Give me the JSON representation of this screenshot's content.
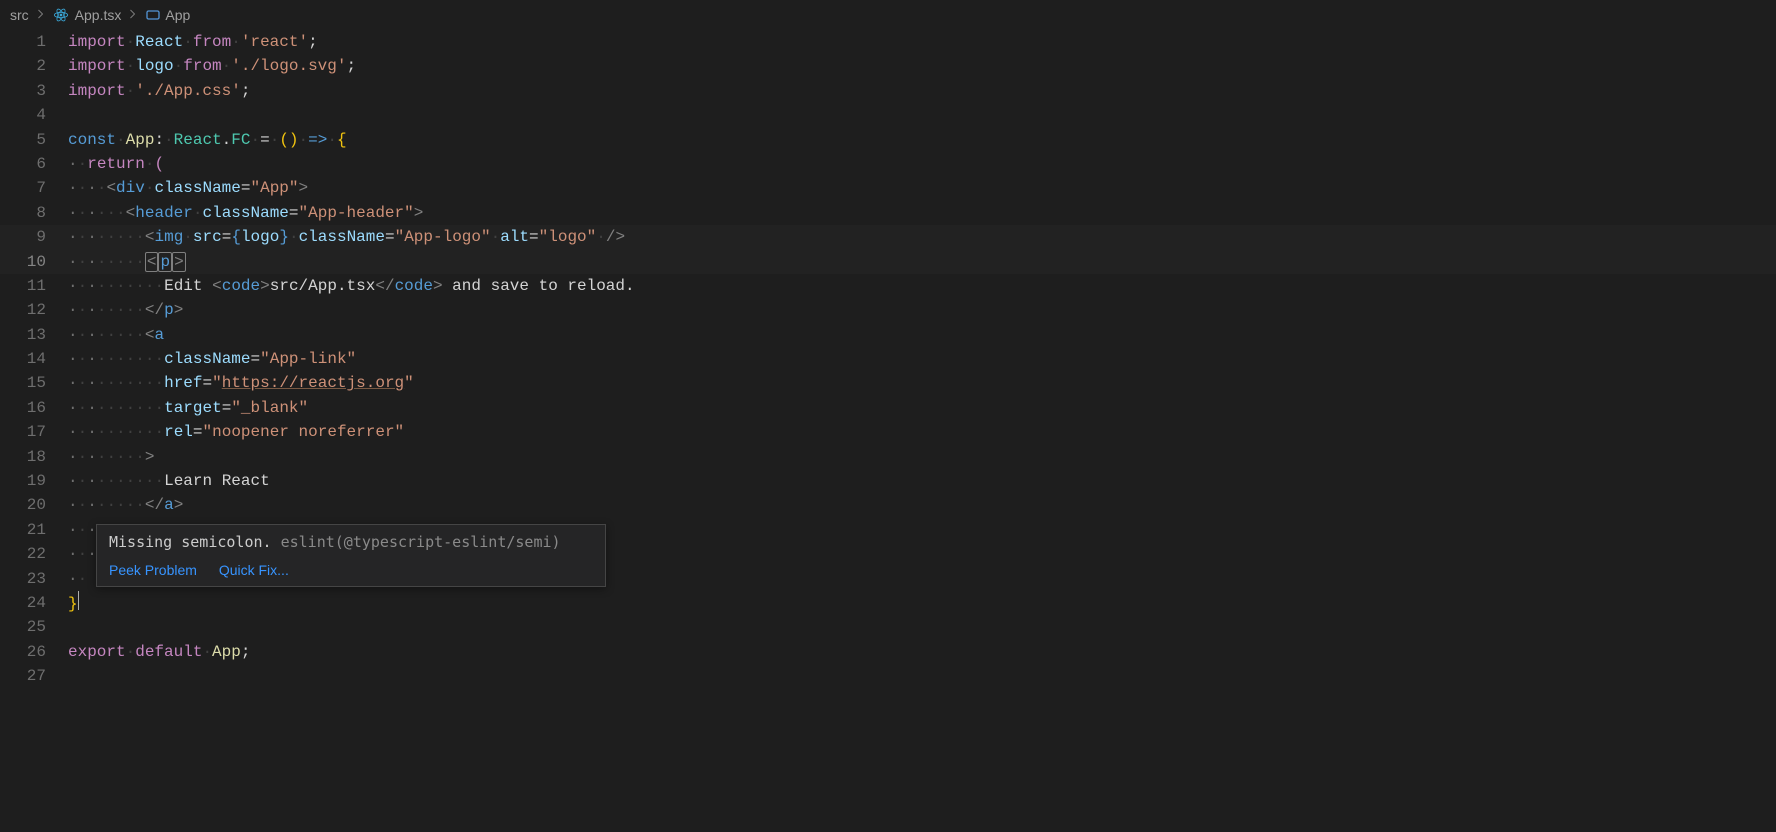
{
  "breadcrumb": {
    "folder": "src",
    "file": "App.tsx",
    "symbol": "App"
  },
  "code": {
    "l1_import": "import",
    "l1_react": "React",
    "l1_from": "from",
    "l1_str": "'react'",
    "l2_logo": "logo",
    "l2_str": "'./logo.svg'",
    "l3_str": "'./App.css'",
    "l5_const": "const",
    "l5_app": "App",
    "l5_reactfc": "React",
    "l5_fc": "FC",
    "l6_return": "return",
    "l7_div": "div",
    "l7_cn": "className",
    "l7_app": "\"App\"",
    "l8_header": "header",
    "l8_cn": "className",
    "l8_val": "\"App-header\"",
    "l9_img": "img",
    "l9_src": "src",
    "l9_logo": "logo",
    "l9_cn": "className",
    "l9_cnval": "\"App-logo\"",
    "l9_alt": "alt",
    "l9_altval": "\"logo\"",
    "l10_p": "p",
    "l11_edit": "Edit ",
    "l11_code": "code",
    "l11_path": "src/App.tsx",
    "l11_tail": " and save to reload.",
    "l12_p": "p",
    "l13_a": "a",
    "l14_cn": "className",
    "l14_val": "\"App-link\"",
    "l15_href": "href",
    "l15_val": "https://reactjs.org",
    "l16_target": "target",
    "l16_val": "\"_blank\"",
    "l17_rel": "rel",
    "l17_val": "\"noopener noreferrer\"",
    "l19_txt": "Learn React",
    "l20_a": "a",
    "l26_export": "export",
    "l26_default": "default",
    "l26_app": "App"
  },
  "hover": {
    "message": "Missing semicolon.",
    "rule": "eslint(@typescript-eslint/semi)",
    "peek": "Peek Problem",
    "quickfix": "Quick Fix..."
  },
  "lines": 27
}
